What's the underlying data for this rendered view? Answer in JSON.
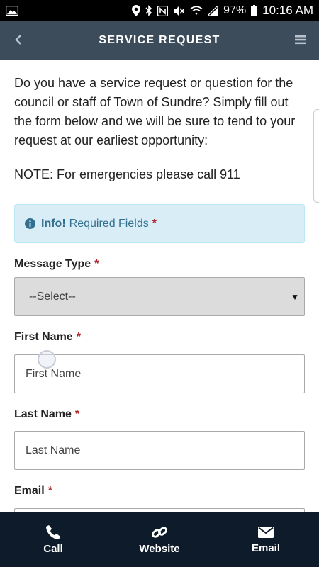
{
  "status_bar": {
    "battery": "97%",
    "time": "10:16 AM"
  },
  "header": {
    "title": "SERVICE REQUEST",
    "back_icon": "chevron-left-icon",
    "menu_icon": "hamburger-menu-icon"
  },
  "intro": {
    "text": "Do you have a service request or question for the council or staff of Town of Sundre? Simply fill out the form below and we will be sure to tend to your request at our earliest opportunity:",
    "note": "NOTE: For emergencies please call 911"
  },
  "alert": {
    "icon": "info-circle-icon",
    "strong": "Info!",
    "text": "Required Fields",
    "required_mark": "*"
  },
  "form": {
    "message_type": {
      "label": "Message Type",
      "required_mark": "*",
      "value": "--Select--"
    },
    "first_name": {
      "label": "First Name",
      "required_mark": "*",
      "placeholder": "First Name"
    },
    "last_name": {
      "label": "Last Name",
      "required_mark": "*",
      "placeholder": "Last Name"
    },
    "email": {
      "label": "Email",
      "required_mark": "*"
    }
  },
  "bottom_nav": [
    {
      "label": "Call",
      "icon": "phone-icon"
    },
    {
      "label": "Website",
      "icon": "link-icon"
    },
    {
      "label": "Email",
      "icon": "envelope-icon"
    }
  ],
  "colors": {
    "header_bg": "#3d4c5a",
    "bottom_bg": "#0d1b2a",
    "alert_bg": "#d9edf7",
    "alert_text": "#31708f",
    "required": "#b0272d"
  }
}
